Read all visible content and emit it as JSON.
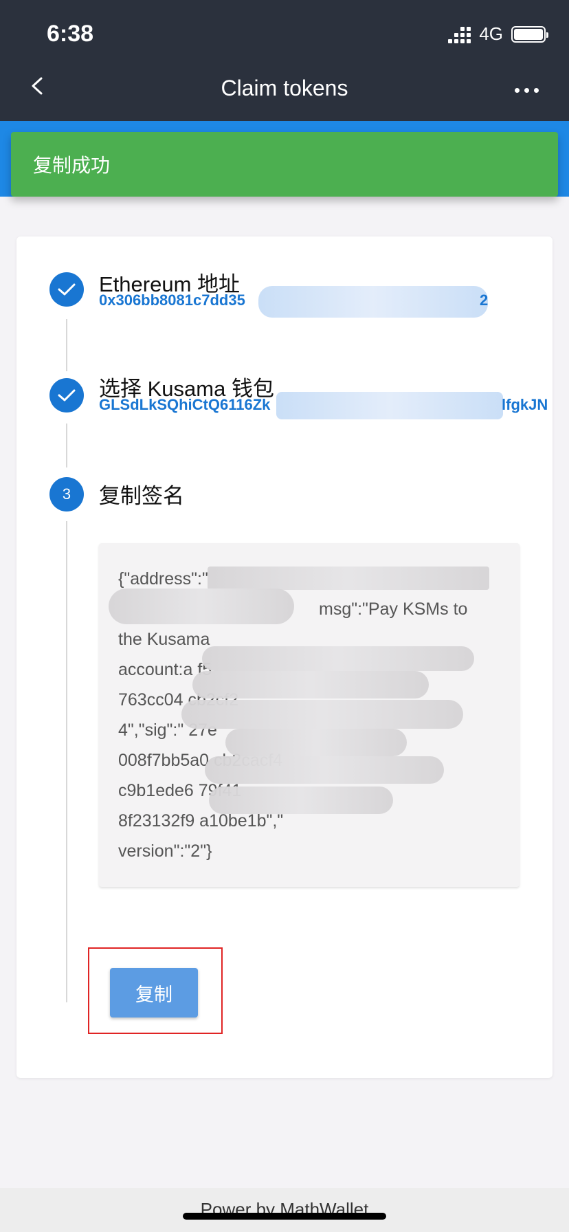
{
  "status_bar": {
    "time": "6:38",
    "network": "4G"
  },
  "nav": {
    "title": "Claim tokens"
  },
  "toast": {
    "message": "复制成功"
  },
  "steps": [
    {
      "indicator": "✓",
      "title": "Ethereum 地址",
      "value_start": "0x306bb8081c7dd35",
      "value_end": "2"
    },
    {
      "indicator": "✓",
      "title": "选择 Kusama 钱包",
      "value_start": "GLSdLkSQhiCtQ6116Zk",
      "value_end": "lfgkJN"
    },
    {
      "indicator": "3",
      "title": "复制签名"
    }
  ],
  "signature": {
    "lines": [
      "{\"address\":\"",
      "msg\":\"Pay KSMs to",
      "the Kusama",
      "account:a                          f5",
      "763cc04                           cb2cf2",
      "4\",\"sig\":\"                          27e",
      "008f7bb5a0                      cb2cacf4",
      "c9b1ede6                          79f41",
      "8f23132f9                       a10be1b\",\"",
      "version\":\"2\"}"
    ]
  },
  "copy_button": {
    "label": "复制"
  },
  "footer": {
    "text": "Power by MathWallet"
  },
  "colors": {
    "header_bg": "#2b313d",
    "toast_bg": "#4caf50",
    "accent_blue": "#1976d2",
    "button_blue": "#5c9ce3",
    "highlight_red": "#e02424"
  }
}
